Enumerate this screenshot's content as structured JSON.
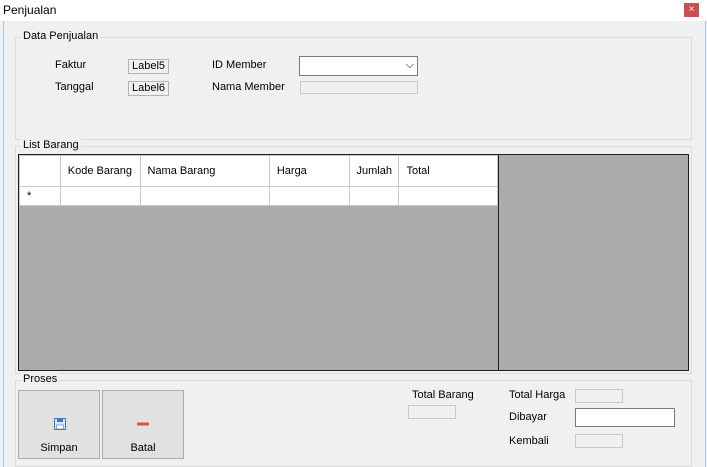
{
  "window": {
    "title": "Penjualan",
    "close_glyph": "×"
  },
  "data_penjualan": {
    "title": "Data Penjualan",
    "faktur_label": "Faktur",
    "faktur_value": "Label5",
    "tanggal_label": "Tanggal",
    "tanggal_value": "Label6",
    "id_member_label": "ID Member",
    "id_member_value": "",
    "dropdown_glyph": "⌵",
    "nama_member_label": "Nama Member",
    "nama_member_value": ""
  },
  "list_barang": {
    "title": "List Barang",
    "columns": [
      "Kode Barang",
      "Nama Barang",
      "Harga",
      "Jumlah",
      "Total"
    ],
    "new_row_marker": "*",
    "rows": []
  },
  "proses": {
    "title": "Proses",
    "simpan_label": "Simpan",
    "batal_label": "Batal",
    "total_barang_label": "Total Barang",
    "total_barang_value": "",
    "total_harga_label": "Total Harga",
    "total_harga_value": "",
    "dibayar_label": "Dibayar",
    "dibayar_value": "",
    "kembali_label": "Kembali",
    "kembali_value": ""
  },
  "icons": {
    "simpan": "floppy-disk-icon",
    "batal": "minus-icon",
    "close": "close-icon"
  },
  "colors": {
    "close_button": "#c75050",
    "grid_background": "#ababab",
    "batal_icon": "#d9534f",
    "simpan_icon": "#3a78c8"
  }
}
